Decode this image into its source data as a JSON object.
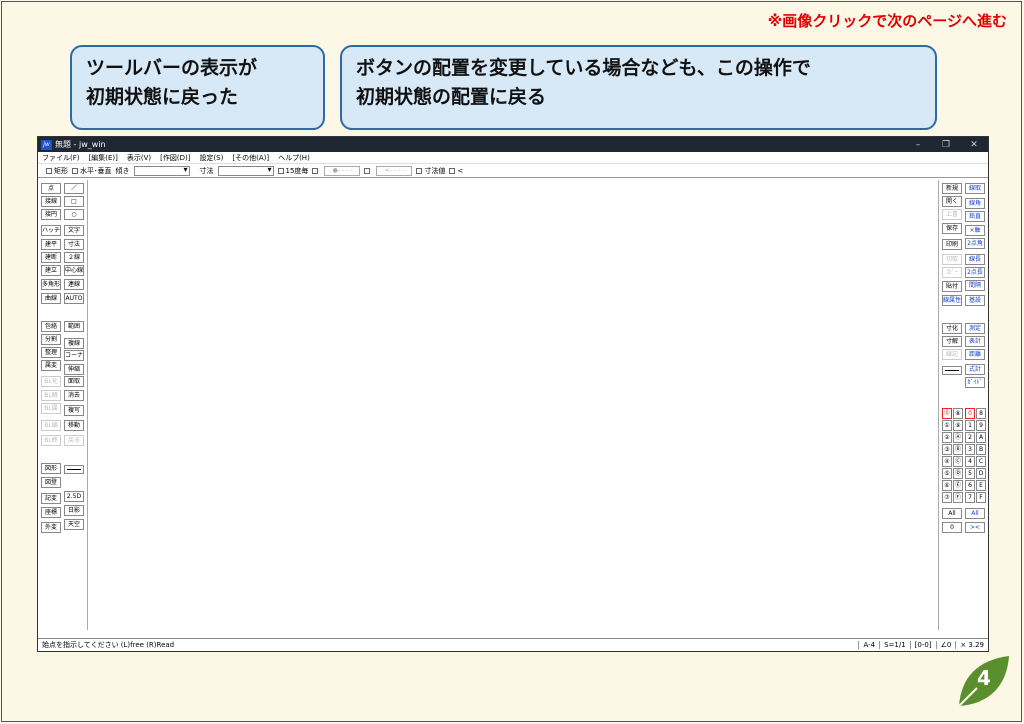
{
  "notice": "※画像クリックで次のページへ進む",
  "bubbles": {
    "b1_line1": "ツールバーの表示が",
    "b1_line2": "初期状態に戻った",
    "b2_line1": "ボタンの配置を変更している場合なども、この操作で",
    "b2_line2": "初期状態の配置に戻る"
  },
  "window": {
    "title": "無題 - jw_win",
    "logo": "jw",
    "controls": [
      "–",
      "❐",
      "✕"
    ]
  },
  "menu": [
    "ファイル(F)",
    "[編集(E)]",
    "表示(V)",
    "[作図(D)]",
    "設定(S)",
    "[その他(A)]",
    "ヘルプ(H)"
  ],
  "toolbar": {
    "rect": "矩形",
    "hv": "水平･垂直",
    "slope": "傾き",
    "dim": "寸法",
    "deg15": "15度毎",
    "dot_btn": "●- - - -",
    "arrow_btn": "<- - - -",
    "dim_value": "寸法値",
    "lt": "<"
  },
  "left_buttons": {
    "c1": [
      "点",
      "接線",
      "接円",
      "ハッチ",
      "建平",
      "建断",
      "建立",
      "多角形",
      "曲線",
      "包絡",
      "分割",
      "整理",
      "属変",
      "BL化",
      "BL解",
      "BL属",
      "BL編",
      "BL終",
      "図形",
      "図登",
      "記変",
      "座標",
      "外変"
    ],
    "c2": [
      "□",
      "○",
      "文字",
      "寸法",
      "２線",
      "中心線",
      "連線",
      "AUTO",
      "範囲",
      "複線",
      "コーナー",
      "伸縮",
      "面取",
      "消去",
      "複写",
      "移動",
      "戻る",
      "2.5D",
      "日影",
      "天空"
    ],
    "c2_first": "／"
  },
  "right_buttons": {
    "c1": [
      "新規",
      "開く",
      "上書",
      "保存",
      "印刷",
      "切取",
      "ｺﾋﾟｰ",
      "貼付",
      "線属性",
      "寸化",
      "寸解",
      "線記",
      "All",
      "0"
    ],
    "c2": [
      "線取",
      "線角",
      "鉛直",
      "×軸",
      "2点角",
      "線長",
      "2点長",
      "間隔",
      "基設",
      "測定",
      "表計",
      "距離",
      "式計",
      "ｶﾞｲﾄﾞ",
      "All",
      "><"
    ],
    "layers_left": [
      "⓪",
      "①",
      "②",
      "③",
      "④",
      "⑤",
      "⑥",
      "⑦"
    ],
    "layers_left_b": [
      "⑧",
      "⑨",
      "Ⓐ",
      "Ⓑ",
      "Ⓒ",
      "Ⓓ",
      "Ⓔ",
      "Ⓕ"
    ],
    "layers_right": [
      "0",
      "1",
      "2",
      "3",
      "4",
      "5",
      "6",
      "7"
    ],
    "layers_right_b": [
      "8",
      "9",
      "A",
      "B",
      "C",
      "D",
      "E",
      "F"
    ]
  },
  "status": {
    "text": "始点を指示してください (L)free (R)Read",
    "paper": "A-4",
    "scale": "S=1/1",
    "layer": "[0-0]",
    "angle": "∠0",
    "factor": "× 3.29"
  },
  "page_number": "4",
  "colors": {
    "accent": "#2d6aa8",
    "bubble_bg": "#d7e8f7",
    "notice": "#e00000",
    "leaf": "#5a8f2e"
  }
}
